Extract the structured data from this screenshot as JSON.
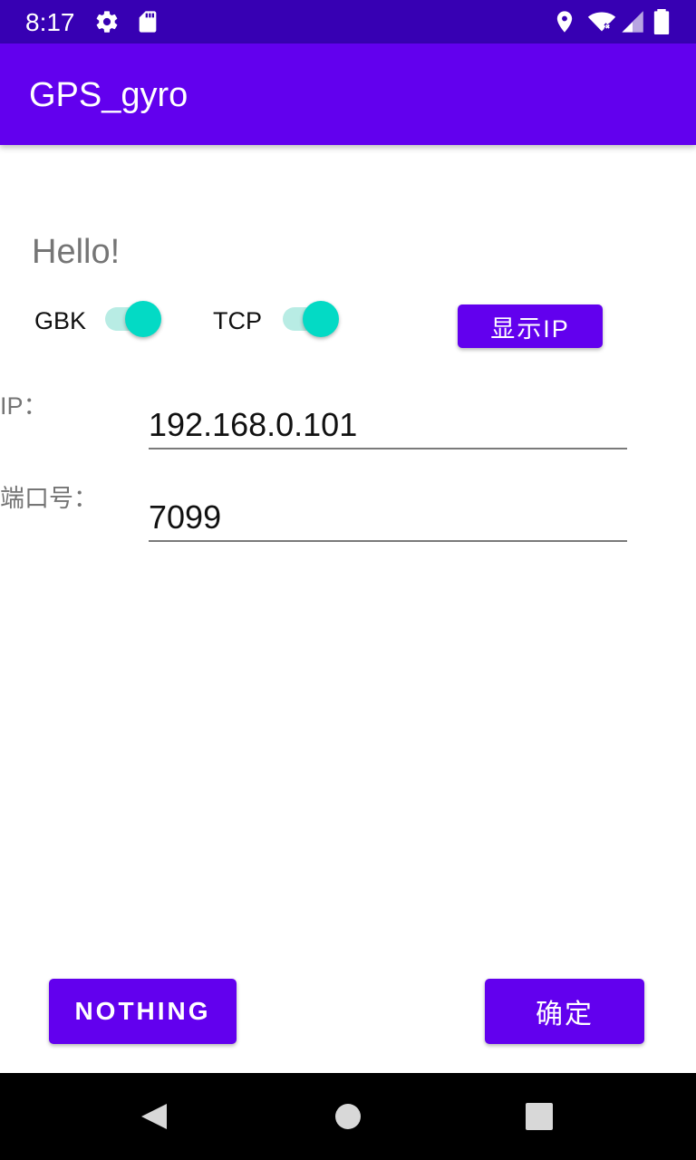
{
  "status_bar": {
    "time": "8:17",
    "icons": [
      "settings-icon",
      "sd-card-icon",
      "location-icon",
      "wifi-icon",
      "signal-icon",
      "battery-icon"
    ]
  },
  "app_bar": {
    "title": "GPS_gyro"
  },
  "main": {
    "greeting": "Hello!",
    "toggles": [
      {
        "label": "GBK",
        "on": true
      },
      {
        "label": "TCP",
        "on": true
      }
    ],
    "show_ip_button": "显示IP",
    "ip_field": {
      "label": "IP：",
      "value": "192.168.0.101"
    },
    "port_field": {
      "label": "端口号：",
      "value": "7099"
    }
  },
  "buttons": {
    "nothing": "NOTHING",
    "confirm": "确定"
  },
  "nav_bar": {
    "icons": [
      "back-icon",
      "home-icon",
      "recents-icon"
    ]
  },
  "colors": {
    "primary": "#6200ee",
    "primary_dark": "#3700b3",
    "accent": "#03dac5"
  }
}
